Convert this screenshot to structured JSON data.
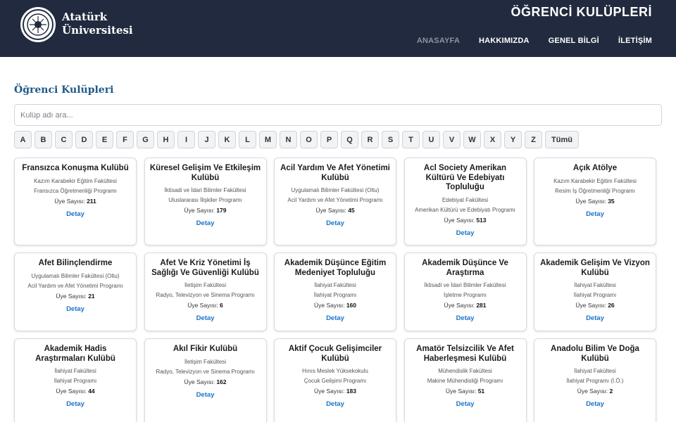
{
  "header": {
    "university_name": [
      "Atatürk",
      "Üniversitesi"
    ],
    "site_title": "ÖĞRENCİ KULÜPLERİ",
    "nav": [
      {
        "label": "ANASAYFA",
        "active": true
      },
      {
        "label": "HAKKIMIZDA",
        "active": false
      },
      {
        "label": "GENEL BİLGİ",
        "active": false
      },
      {
        "label": "İLETİŞİM",
        "active": false
      }
    ]
  },
  "main": {
    "heading": "Öğrenci Kulüpleri",
    "search_placeholder": "Kulüp adı ara...",
    "letters": [
      "A",
      "B",
      "C",
      "D",
      "E",
      "F",
      "G",
      "H",
      "I",
      "J",
      "K",
      "L",
      "M",
      "N",
      "O",
      "P",
      "Q",
      "R",
      "S",
      "T",
      "U",
      "V",
      "W",
      "X",
      "Y",
      "Z",
      "Tümü"
    ],
    "members_label": "Üye Sayısı:",
    "detail_label": "Detay",
    "clubs": [
      {
        "name": "Fransızca Konuşma Kulübü",
        "faculty": "Kazım Karabekir Eğitim Fakültesi",
        "program": "Fransızca Öğretmenliği Programı",
        "members": "211"
      },
      {
        "name": "Küresel Gelişim Ve Etkileşim Kulübü",
        "faculty": "İktisadi ve İdari Bilimler Fakültesi",
        "program": "Uluslararası İlişkiler Programı",
        "members": "179"
      },
      {
        "name": "Acil Yardım Ve Afet Yönetimi Kulübü",
        "faculty": "Uygulamalı Bilimler Fakültesi (Oltu)",
        "program": "Acil Yardım ve Afet Yönetimi Programı",
        "members": "45"
      },
      {
        "name": "Acl Society Amerikan Kültürü Ve Edebiyatı Topluluğu",
        "faculty": "Edebiyat Fakültesi",
        "program": "Amerikan Kültürü ve Edebiyatı Programı",
        "members": "513"
      },
      {
        "name": "Açık Atölye",
        "faculty": "Kazım Karabekir Eğitim Fakültesi",
        "program": "Resim İş Öğretmenliği Programı",
        "members": "35"
      },
      {
        "name": "Afet Bilinçlendirme",
        "faculty": "Uygulamalı Bilimler Fakültesi (Oltu)",
        "program": "Acil Yardım ve Afet Yönetimi Programı",
        "members": "21"
      },
      {
        "name": "Afet Ve Kriz Yönetimi İş Sağlığı Ve Güvenliği Kulübü",
        "faculty": "İletişim Fakültesi",
        "program": "Radyo, Televizyon ve Sinema Programı",
        "members": "6"
      },
      {
        "name": "Akademik Düşünce Eğitim Medeniyet Topluluğu",
        "faculty": "İlahiyat Fakültesi",
        "program": "İlahiyat Programı",
        "members": "160"
      },
      {
        "name": "Akademik Düşünce Ve Araştırma",
        "faculty": "İktisadi ve İdari Bilimler Fakültesi",
        "program": "İşletme Programı",
        "members": "281"
      },
      {
        "name": "Akademik Gelişim Ve Vizyon Kulübü",
        "faculty": "İlahiyat Fakültesi",
        "program": "İlahiyat Programı",
        "members": "26"
      },
      {
        "name": "Akademik Hadis Araştırmaları Kulübü",
        "faculty": "İlahiyat Fakültesi",
        "program": "İlahiyat Programı",
        "members": "44"
      },
      {
        "name": "Akıl Fikir Kulübü",
        "faculty": "İletişim Fakültesi",
        "program": "Radyo, Televizyon ve Sinema Programı",
        "members": "162"
      },
      {
        "name": "Aktif Çocuk Gelişimciler Kulübü",
        "faculty": "Hınıs Meslek Yüksekokulu",
        "program": "Çocuk Gelişimi Programı",
        "members": "183"
      },
      {
        "name": "Amatör Telsizcilik Ve Afet Haberleşmesi Kulübü",
        "faculty": "Mühendislik Fakültesi",
        "program": "Makine Mühendisliği Programı",
        "members": "51"
      },
      {
        "name": "Anadolu Bilim Ve Doğa Kulübü",
        "faculty": "İlahiyat Fakültesi",
        "program": "İlahiyat Programı (İ.Ö.)",
        "members": "2"
      }
    ]
  }
}
